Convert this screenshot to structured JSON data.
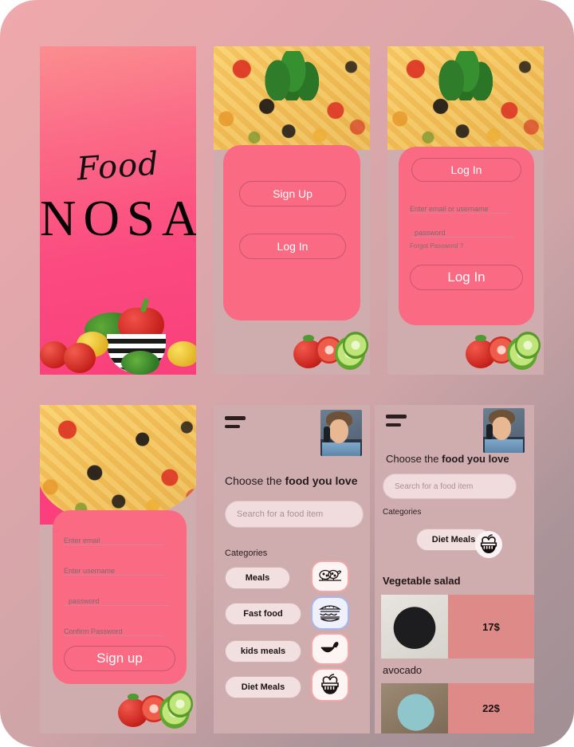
{
  "theme": {
    "brand_pink": "#fb6a83",
    "card_pink": "#fb6a83",
    "board_bg_start": "#f0a8ab",
    "board_bg_end": "#a08f94",
    "price_tile": "#dd8a88",
    "chip_bg": "#f2e0e0"
  },
  "screen1_splash": {
    "script_word": "Food",
    "brand_word": "NOSA"
  },
  "screen2_welcome": {
    "signup_button": "Sign Up",
    "login_button": "Log In"
  },
  "screen3_login": {
    "title_button": "Log In",
    "email_placeholder": "Enter email or username",
    "password_placeholder": "password",
    "forgot_link": "Forgot Password ?",
    "submit_button": "Log In"
  },
  "screen4_signup": {
    "email_placeholder": "Enter email",
    "username_placeholder": "Enter username",
    "password_placeholder": "password",
    "confirm_placeholder": "Confirm Password",
    "submit_button": "Sign up"
  },
  "screen5_categories": {
    "heading_regular": "Choose the ",
    "heading_bold": "food you love",
    "search_placeholder": "Search for a food item",
    "categories_label": "Categories",
    "categories": [
      {
        "label": "Meals",
        "icon": "roast-chicken-icon",
        "accent": "red"
      },
      {
        "label": "Fast food",
        "icon": "burger-icon",
        "accent": "blue"
      },
      {
        "label": "kids meals",
        "icon": "bowl-spoon-icon",
        "accent": "red"
      },
      {
        "label": "Diet Meals",
        "icon": "apple-basket-icon",
        "accent": "red"
      }
    ]
  },
  "screen6_results": {
    "heading_regular": "Choose the ",
    "heading_bold": "food you love",
    "search_placeholder": "Search for a food item",
    "categories_label": "Categories",
    "selected_category": "Diet Meals",
    "selected_category_icon": "apple-basket-icon",
    "items": [
      {
        "name": "Vegetable salad",
        "price": "17$"
      },
      {
        "name": "avocado",
        "price": "22$"
      }
    ]
  }
}
